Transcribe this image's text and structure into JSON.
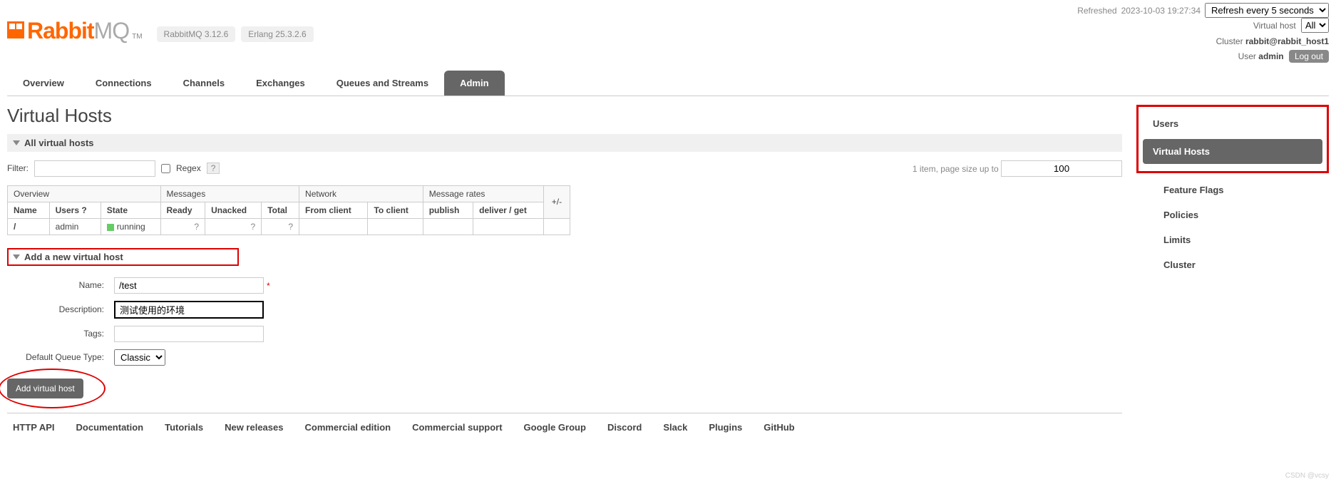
{
  "refresh": {
    "label": "Refreshed",
    "timestamp": "2023-10-03 19:27:34",
    "interval_selected": "Refresh every 5 seconds"
  },
  "logo": {
    "part1": "Rabbit",
    "part2": "MQ",
    "tm": "TM"
  },
  "versions": {
    "rabbitmq": "RabbitMQ 3.12.6",
    "erlang": "Erlang 25.3.2.6"
  },
  "header_right": {
    "vhost_label": "Virtual host",
    "vhost_selected": "All",
    "cluster_label": "Cluster",
    "cluster_value": "rabbit@rabbit_host1",
    "user_label": "User",
    "user_value": "admin",
    "logout": "Log out"
  },
  "nav": [
    "Overview",
    "Connections",
    "Channels",
    "Exchanges",
    "Queues and Streams",
    "Admin"
  ],
  "nav_active_index": 5,
  "page_title": "Virtual Hosts",
  "section_all": "All virtual hosts",
  "filter": {
    "label": "Filter:",
    "regex_label": "Regex",
    "help": "?",
    "item_summary": "1 item, page size up to",
    "page_size": "100"
  },
  "table": {
    "groups": [
      "Overview",
      "Messages",
      "Network",
      "Message rates"
    ],
    "plus_minus": "+/-",
    "columns": {
      "name": "Name",
      "users": "Users",
      "users_help": "?",
      "state": "State",
      "ready": "Ready",
      "unacked": "Unacked",
      "total": "Total",
      "from_client": "From client",
      "to_client": "To client",
      "publish": "publish",
      "deliver_get": "deliver / get"
    },
    "rows": [
      {
        "name": "/",
        "users": "admin",
        "state": "running",
        "ready": "?",
        "unacked": "?",
        "total": "?",
        "from_client": "",
        "to_client": "",
        "publish": "",
        "deliver_get": ""
      }
    ]
  },
  "add_section": {
    "title": "Add a new virtual host",
    "fields": {
      "name_label": "Name:",
      "name_value": "/test",
      "desc_label": "Description:",
      "desc_value": "测试使用的环境",
      "tags_label": "Tags:",
      "tags_value": "",
      "dqt_label": "Default Queue Type:",
      "dqt_value": "Classic"
    },
    "submit": "Add virtual host"
  },
  "footer": [
    "HTTP API",
    "Documentation",
    "Tutorials",
    "New releases",
    "Commercial edition",
    "Commercial support",
    "Google Group",
    "Discord",
    "Slack",
    "Plugins",
    "GitHub"
  ],
  "sidebar": {
    "items": [
      "Users",
      "Virtual Hosts",
      "Feature Flags",
      "Policies",
      "Limits",
      "Cluster"
    ],
    "active_index": 1
  },
  "watermark": "CSDN @vcsy"
}
